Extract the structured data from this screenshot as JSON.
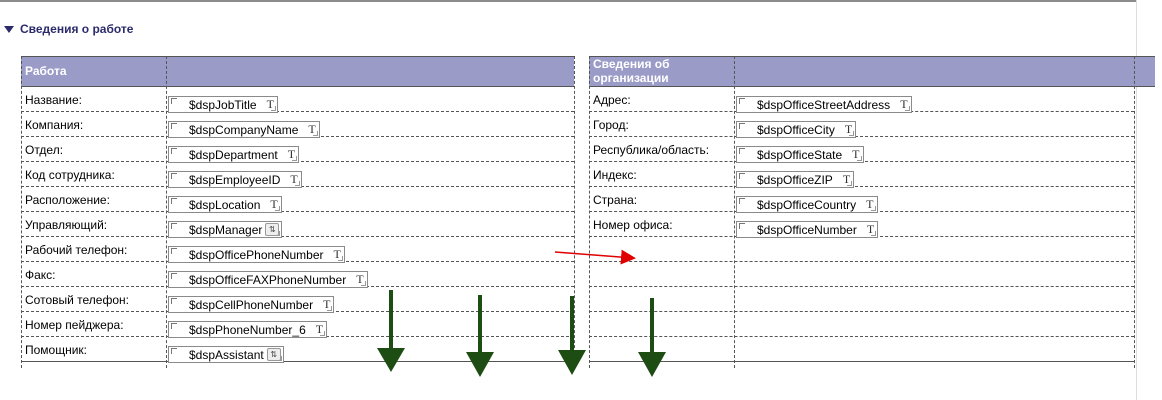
{
  "section": {
    "title": "Сведения о работе",
    "expand_icon": "triangle-down-icon"
  },
  "work": {
    "header": "Работа",
    "rows": [
      {
        "label": "Название:",
        "field": "$dspJobTitle",
        "icon": "T"
      },
      {
        "label": "Компания:",
        "field": "$dspCompanyName",
        "icon": "T"
      },
      {
        "label": "Отдел:",
        "field": "$dspDepartment",
        "icon": "T"
      },
      {
        "label": "Код сотрудника:",
        "field": "$dspEmployeeID",
        "icon": "T"
      },
      {
        "label": "Расположение:",
        "field": "$dspLocation",
        "icon": "T"
      },
      {
        "label": "Управляющий:",
        "field": "$dspManager",
        "icon": "picker"
      },
      {
        "label": "Рабочий телефон:",
        "field": "$dspOfficePhoneNumber",
        "icon": "T"
      },
      {
        "label": "Факс:",
        "field": "$dspOfficeFAXPhoneNumber",
        "icon": "T"
      },
      {
        "label": "Сотовый телефон:",
        "field": "$dspCellPhoneNumber",
        "icon": "T"
      },
      {
        "label": "Номер пейджера:",
        "field": "$dspPhoneNumber_6",
        "icon": "T"
      },
      {
        "label": "Помощник:",
        "field": "$dspAssistant",
        "icon": "picker"
      }
    ]
  },
  "org": {
    "header_line1": "Сведения об",
    "header_line2": "организации",
    "rows": [
      {
        "label": "Адрес:",
        "field": "$dspOfficeStreetAddress",
        "icon": "T"
      },
      {
        "label": "Город:",
        "field": "$dspOfficeCity",
        "icon": "T"
      },
      {
        "label": "Республика/область:",
        "field": "$dspOfficeState",
        "icon": "T"
      },
      {
        "label": "Индекс:",
        "field": "$dspOfficeZIP",
        "icon": "T"
      },
      {
        "label": "Страна:",
        "field": "$dspOfficeCountry",
        "icon": "T"
      },
      {
        "label": "Номер офиса:",
        "field": "$dspOfficeNumber",
        "icon": "T"
      }
    ]
  },
  "colors": {
    "header_bg": "#9b9bc8",
    "title": "#2b2b6b",
    "red_arrow": "#e00000",
    "green_arrow": "#1e4d14"
  }
}
